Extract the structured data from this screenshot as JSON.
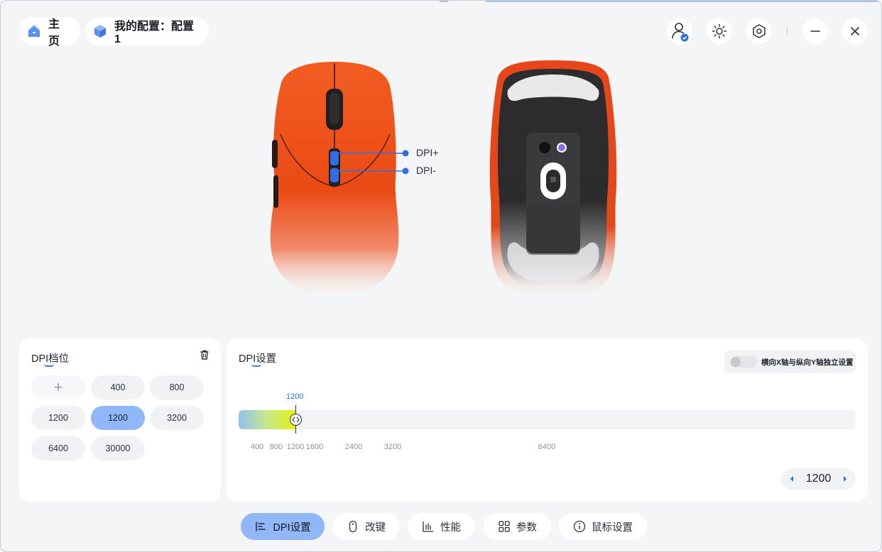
{
  "header": {
    "home_label": "主页",
    "config_label": "我的配置：配置1"
  },
  "toolbar": {
    "icons": [
      "user-verified-icon",
      "brightness-icon",
      "settings-hex-icon",
      "minimize-icon",
      "close-icon"
    ]
  },
  "mouse_view": {
    "button_labels": [
      "DPI+",
      "DPI-"
    ]
  },
  "dpi_levels": {
    "title": "DPI档位",
    "add_symbol": "+",
    "chips": [
      "400",
      "800",
      "1200",
      "1200",
      "3200",
      "6400",
      "30000"
    ],
    "active_index": 3
  },
  "dpi_settings": {
    "title": "DPI设置",
    "xy_toggle_label": "横向X轴与纵向Y轴独立设置",
    "xy_toggle_on": false,
    "current_value": "1200",
    "slider_max": 30000,
    "slider_value": 1200,
    "tick_labels": [
      "400",
      "800",
      "1200",
      "1600",
      "2400",
      "3200",
      "6400"
    ],
    "stepper_value": "1200"
  },
  "bottom_nav": {
    "items": [
      {
        "label": "DPI设置",
        "icon": "dpi-bars-icon",
        "active": true
      },
      {
        "label": "改键",
        "icon": "mouse-icon",
        "active": false
      },
      {
        "label": "性能",
        "icon": "chart-icon",
        "active": false
      },
      {
        "label": "参数",
        "icon": "grid-icon",
        "active": false
      },
      {
        "label": "鼠标设置",
        "icon": "info-icon",
        "active": false
      }
    ]
  },
  "colors": {
    "accent": "#91b7f9",
    "link_blue": "#2e6fd0",
    "mouse_orange": "#f05a1e",
    "background": "#f4f5f7"
  }
}
